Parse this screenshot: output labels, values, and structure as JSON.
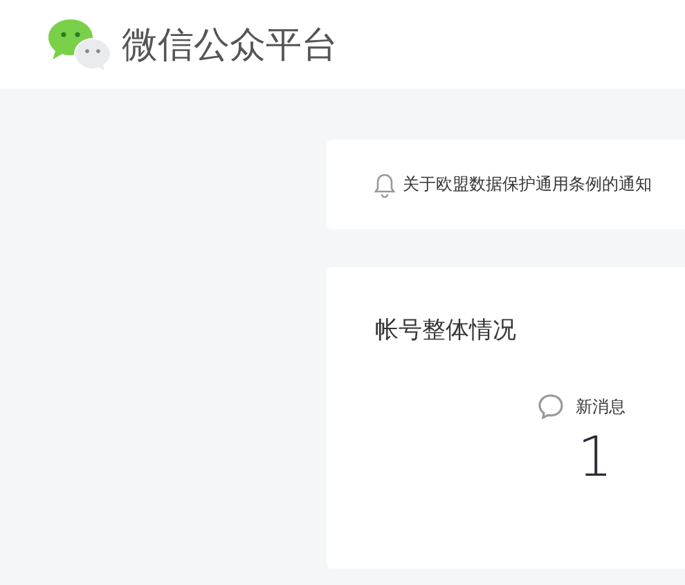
{
  "header": {
    "title": "微信公众平台"
  },
  "notice": {
    "text": "关于欧盟数据保护通用条例的通知"
  },
  "overview": {
    "title": "帐号整体情况",
    "stats": [
      {
        "label": "新消息",
        "value": "1"
      }
    ]
  }
}
